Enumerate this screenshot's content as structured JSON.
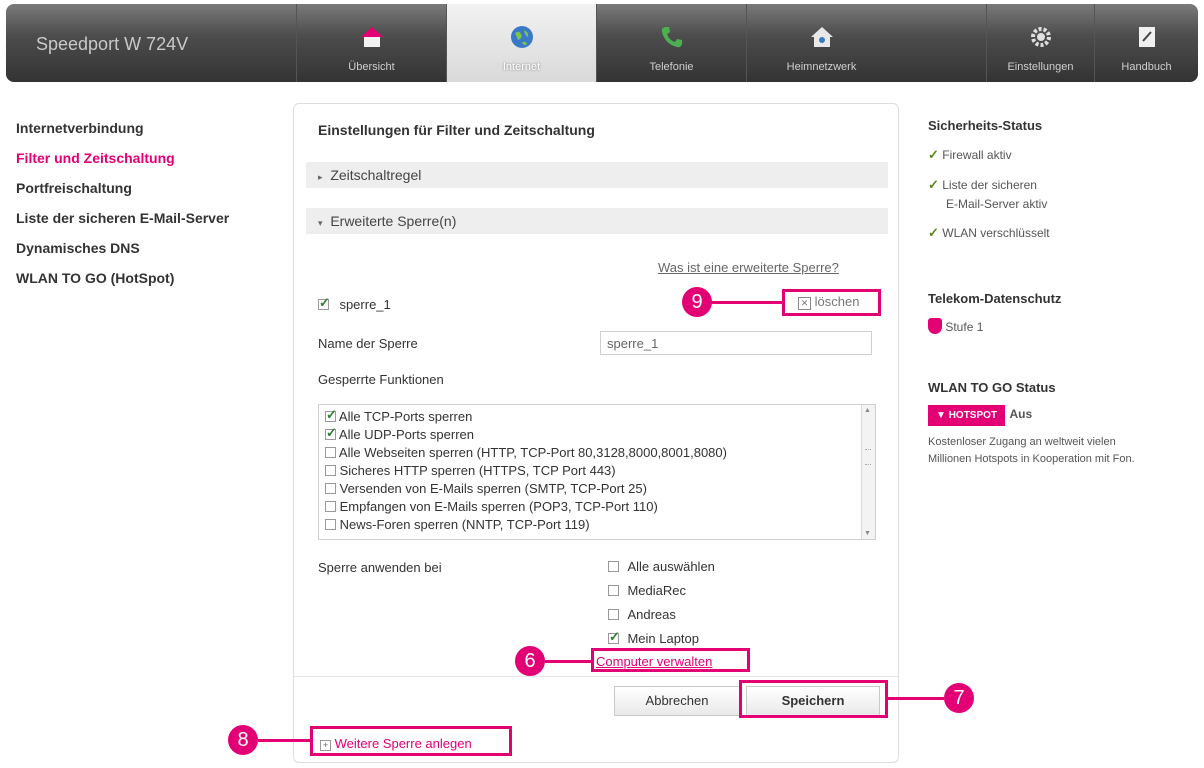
{
  "header": {
    "brand": "Speedport W 724V",
    "nav": [
      {
        "label": "Übersicht",
        "icon": "home-icon"
      },
      {
        "label": "Internet",
        "icon": "globe-icon"
      },
      {
        "label": "Telefonie",
        "icon": "phone-icon"
      },
      {
        "label": "Heimnetzwerk",
        "icon": "home-network-icon"
      },
      {
        "label": "Einstellungen",
        "icon": "gear-icon"
      },
      {
        "label": "Handbuch",
        "icon": "manual-icon"
      }
    ],
    "active_index": 1
  },
  "sidebar": {
    "items": [
      {
        "label": "Internetverbindung"
      },
      {
        "label": "Filter und Zeitschaltung"
      },
      {
        "label": "Portfreischaltung"
      },
      {
        "label": "Liste der sicheren E-Mail-Server"
      },
      {
        "label": "Dynamisches DNS"
      },
      {
        "label": "WLAN TO GO (HotSpot)"
      }
    ],
    "active_index": 1
  },
  "main": {
    "title": "Einstellungen für Filter und Zeitschaltung",
    "section_timer": "Zeitschaltregel",
    "section_block": "Erweiterte Sperre(n)",
    "help_link": "Was ist eine erweiterte Sperre?",
    "block_entry": {
      "name": "sperre_1",
      "checked": true
    },
    "delete_label": "löschen",
    "name_label": "Name der Sperre",
    "name_value": "sperre_1",
    "functions_label": "Gesperrte Funktionen",
    "functions": [
      {
        "label": "Alle TCP-Ports sperren",
        "checked": true
      },
      {
        "label": "Alle UDP-Ports sperren",
        "checked": true
      },
      {
        "label": "Alle Webseiten sperren (HTTP, TCP-Port 80,3128,8000,8001,8080)",
        "checked": false
      },
      {
        "label": "Sicheres HTTP sperren (HTTPS, TCP Port 443)",
        "checked": false
      },
      {
        "label": "Versenden von E-Mails sperren (SMTP, TCP-Port 25)",
        "checked": false
      },
      {
        "label": "Empfangen von E-Mails sperren (POP3, TCP-Port 110)",
        "checked": false
      },
      {
        "label": "News-Foren sperren (NNTP, TCP-Port 119)",
        "checked": false
      }
    ],
    "apply_label": "Sperre anwenden bei",
    "devices": [
      {
        "label": "Alle auswählen",
        "checked": false
      },
      {
        "label": "MediaRec",
        "checked": false
      },
      {
        "label": "Andreas",
        "checked": false
      },
      {
        "label": "Mein Laptop",
        "checked": true
      }
    ],
    "manage_link": "Computer verwalten",
    "cancel_label": "Abbrechen",
    "save_label": "Speichern",
    "add_block_label": "Weitere Sperre anlegen"
  },
  "callouts": {
    "c6": "6",
    "c7": "7",
    "c8": "8",
    "c9": "9"
  },
  "right": {
    "security_title": "Sicherheits-Status",
    "security_items": [
      "Firewall aktiv",
      "Liste der sicheren",
      "E-Mail-Server aktiv",
      "WLAN verschlüsselt"
    ],
    "privacy_title": "Telekom-Datenschutz",
    "privacy_level": "Stufe 1",
    "wlan_title": "WLAN TO GO Status",
    "hotspot_badge": "HOTSPOT",
    "hotspot_status": "Aus",
    "wlan_desc_1": "Kostenloser Zugang an weltweit vielen",
    "wlan_desc_2": "Millionen Hotspots in Kooperation mit Fon."
  },
  "colors": {
    "accent": "#e20074",
    "check": "#2e7d32"
  }
}
